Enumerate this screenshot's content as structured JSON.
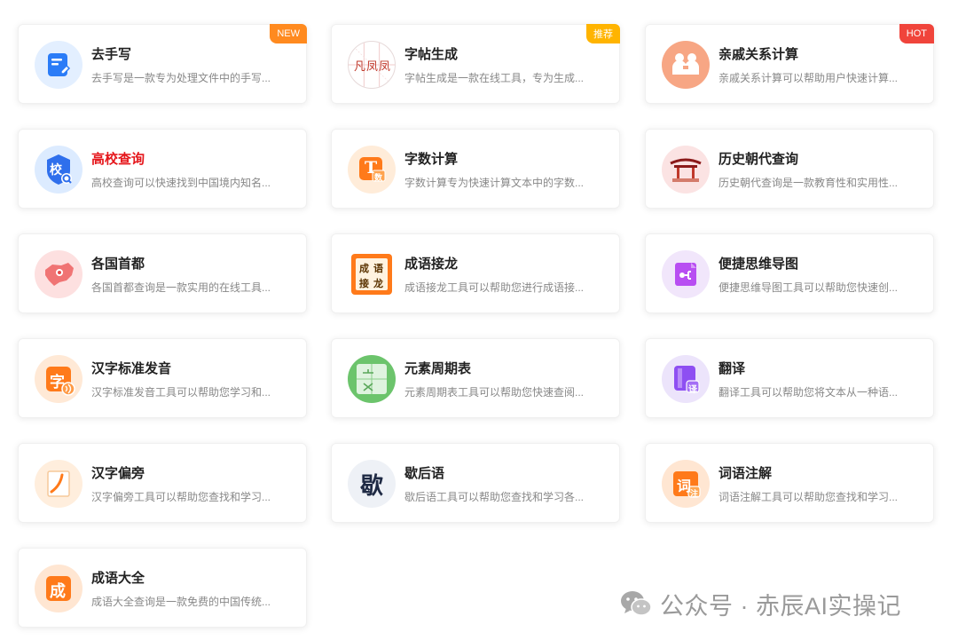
{
  "cards": [
    {
      "id": "qushouxie",
      "title": "去手写",
      "desc": "去手写是一款专为处理文件中的手写...",
      "icon": "document-edit-icon",
      "badge": "NEW"
    },
    {
      "id": "zitie",
      "title": "字帖生成",
      "desc": "字帖生成是一款在线工具，专为生成...",
      "icon": "copybook-icon",
      "badge": "推荐"
    },
    {
      "id": "qinqi",
      "title": "亲戚关系计算",
      "desc": "亲戚关系计算可以帮助用户快速计算...",
      "icon": "family-icon",
      "badge": "HOT"
    },
    {
      "id": "gaoxiao",
      "title": "高校查询",
      "desc": "高校查询可以快速找到中国境内知名...",
      "icon": "school-search-icon",
      "badge": ""
    },
    {
      "id": "zishu",
      "title": "字数计算",
      "desc": "字数计算专为快速计算文本中的字数...",
      "icon": "word-count-icon",
      "badge": ""
    },
    {
      "id": "lishi",
      "title": "历史朝代查询",
      "desc": "历史朝代查询是一款教育性和实用性...",
      "icon": "history-dynasty-icon",
      "badge": ""
    },
    {
      "id": "shoudu",
      "title": "各国首都",
      "desc": "各国首都查询是一款实用的在线工具...",
      "icon": "world-map-icon",
      "badge": ""
    },
    {
      "id": "jielong",
      "title": "成语接龙",
      "desc": "成语接龙工具可以帮助您进行成语接...",
      "icon": "idiom-chain-icon",
      "badge": ""
    },
    {
      "id": "siwei",
      "title": "便捷思维导图",
      "desc": "便捷思维导图工具可以帮助您快速创...",
      "icon": "mindmap-icon",
      "badge": ""
    },
    {
      "id": "fayin",
      "title": "汉字标准发音",
      "desc": "汉字标准发音工具可以帮助您学习和...",
      "icon": "pronunciation-icon",
      "badge": ""
    },
    {
      "id": "zhouqi",
      "title": "元素周期表",
      "desc": "元素周期表工具可以帮助您快速查阅...",
      "icon": "periodic-table-icon",
      "badge": ""
    },
    {
      "id": "fanyi",
      "title": "翻译",
      "desc": "翻译工具可以帮助您将文本从一种语...",
      "icon": "translate-icon",
      "badge": ""
    },
    {
      "id": "pianpang",
      "title": "汉字偏旁",
      "desc": "汉字偏旁工具可以帮助您查找和学习...",
      "icon": "radical-icon",
      "badge": ""
    },
    {
      "id": "xiehouyu",
      "title": "歇后语",
      "desc": "歇后语工具可以帮助您查找和学习各...",
      "icon": "xiehouyu-icon",
      "badge": ""
    },
    {
      "id": "ciyu",
      "title": "词语注解",
      "desc": "词语注解工具可以帮助您查找和学习...",
      "icon": "word-annotation-icon",
      "badge": ""
    },
    {
      "id": "chengyu",
      "title": "成语大全",
      "desc": "成语大全查询是一款免费的中国传统...",
      "icon": "idiom-book-icon",
      "badge": ""
    }
  ],
  "icon_glyphs": {
    "copybook": "凡凤凤",
    "school": "校",
    "word_count": "T",
    "word_count_sub": "数",
    "idiom_chain": [
      "成",
      "语",
      "接",
      "龙"
    ],
    "pronunciation": "字",
    "translate_sub": "译",
    "xiehouyu": "歇",
    "word_annotation": "词",
    "word_annotation_sub": "注",
    "idiom_book": "成"
  },
  "watermark": {
    "text": "公众号 · 赤辰AI实操记"
  },
  "colors": {
    "new": "#ff8a1f",
    "recommend": "#ffb400",
    "hot": "#f0443b",
    "highlight_title": "#e5161b"
  }
}
